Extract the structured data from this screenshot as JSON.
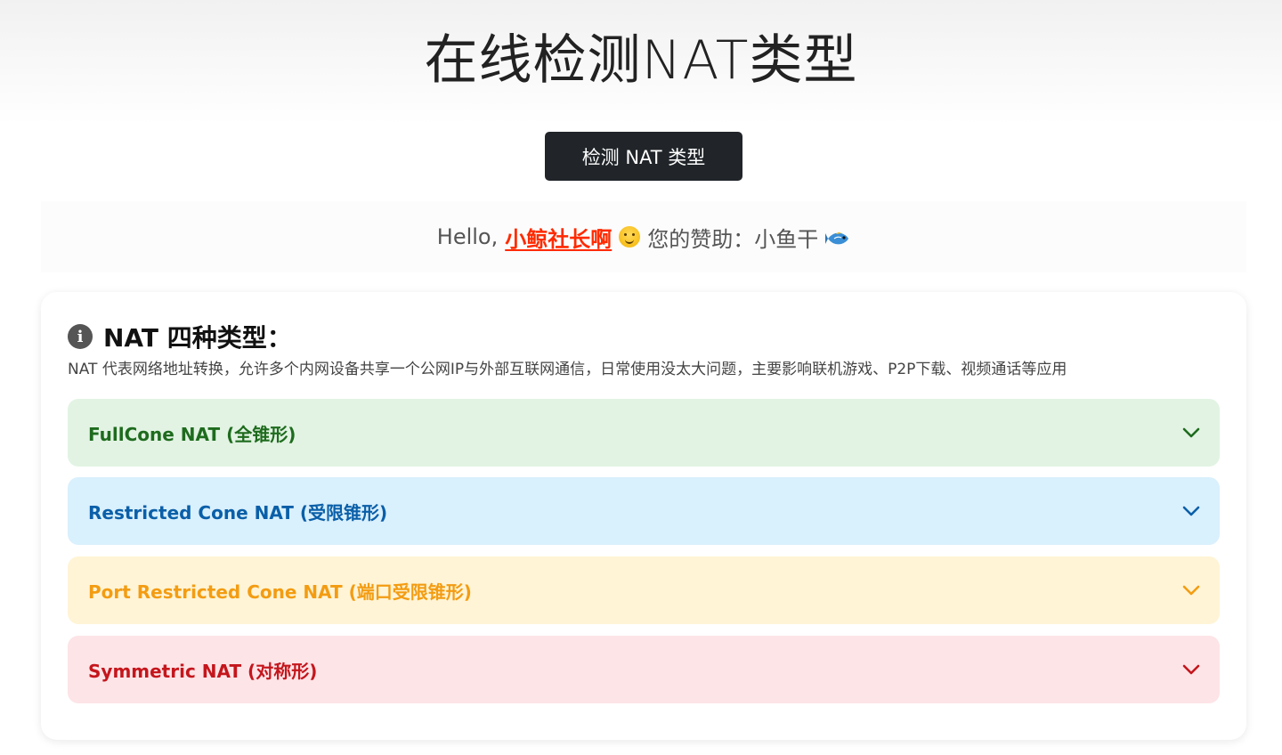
{
  "header": {
    "title": "在线检测NAT类型"
  },
  "detect_button": {
    "label": "检测 NAT 类型"
  },
  "greeting": {
    "prefix": "Hello,",
    "username": "小鲸社长啊",
    "sponsor_text": "您的赞助：小鱼干"
  },
  "info_card": {
    "title": "NAT 四种类型：",
    "description": "NAT 代表网络地址转换，允许多个内网设备共享一个公网IP与外部互联网通信，日常使用没太大问题，主要影响联机游戏、P2P下载、视频通话等应用",
    "items": [
      {
        "label": "FullCone NAT (全锥形)",
        "color": "#1e6b1e",
        "bg": "#e2f3e3"
      },
      {
        "label": "Restricted Cone NAT (受限锥形)",
        "color": "#0a5fa8",
        "bg": "#d9f0fd"
      },
      {
        "label": "Port Restricted Cone NAT (端口受限锥形)",
        "color": "#f39c12",
        "bg": "#fff4d6"
      },
      {
        "label": "Symmetric NAT (对称形)",
        "color": "#c4161c",
        "bg": "#fde4e7"
      }
    ]
  },
  "icons": {
    "info": "info-circle-icon",
    "emoji": "smiling-face-icon",
    "fish": "fish-icon",
    "chevron": "chevron-down-icon"
  }
}
